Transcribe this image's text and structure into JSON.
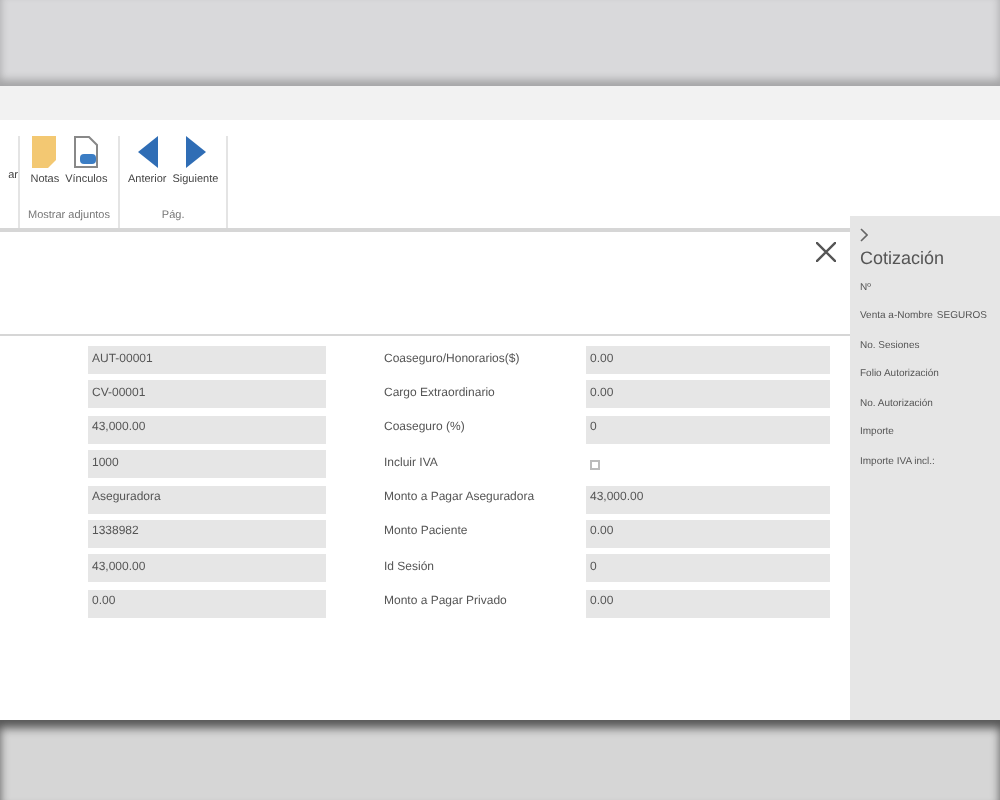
{
  "ribbon": {
    "partial_button": "ar",
    "groups": [
      {
        "label": "Mostrar adjuntos",
        "buttons": [
          {
            "kind": "note",
            "label": "Notas"
          },
          {
            "kind": "link",
            "label": "Vínculos"
          }
        ]
      },
      {
        "label": "Pág.",
        "buttons": [
          {
            "kind": "prev",
            "label": "Anterior"
          },
          {
            "kind": "next",
            "label": "Siguiente"
          }
        ]
      }
    ]
  },
  "form": {
    "left_values": [
      "AUT-00001",
      "CV-00001",
      "43,000.00",
      "1000",
      "Aseguradora",
      "1338982",
      "43,000.00",
      "0.00"
    ],
    "right_fields": [
      {
        "kind": "text",
        "label": "Coaseguro/Honorarios($)",
        "value": "0.00"
      },
      {
        "kind": "text",
        "label": "Cargo Extraordinario",
        "value": "0.00"
      },
      {
        "kind": "text",
        "label": "Coaseguro (%)",
        "value": "0"
      },
      {
        "kind": "checkbox",
        "label": "Incluir IVA",
        "checked": false
      },
      {
        "kind": "text",
        "label": "Monto a Pagar Aseguradora",
        "value": "43,000.00"
      },
      {
        "kind": "text",
        "label": "Monto Paciente",
        "value": "0.00"
      },
      {
        "kind": "text",
        "label": "Id Sesión",
        "value": "0"
      },
      {
        "kind": "text",
        "label": "Monto a Pagar Privado",
        "value": "0.00"
      }
    ]
  },
  "side_panel": {
    "title": "Cotización",
    "items": [
      {
        "label": "Nº"
      },
      {
        "label": "Venta a-Nombre",
        "value": "SEGUROS"
      },
      {
        "label": "No. Sesiones"
      },
      {
        "label": "Folio Autorización"
      },
      {
        "label": "No. Autorización"
      },
      {
        "label": "Importe"
      },
      {
        "label": "Importe IVA incl.:"
      }
    ]
  }
}
